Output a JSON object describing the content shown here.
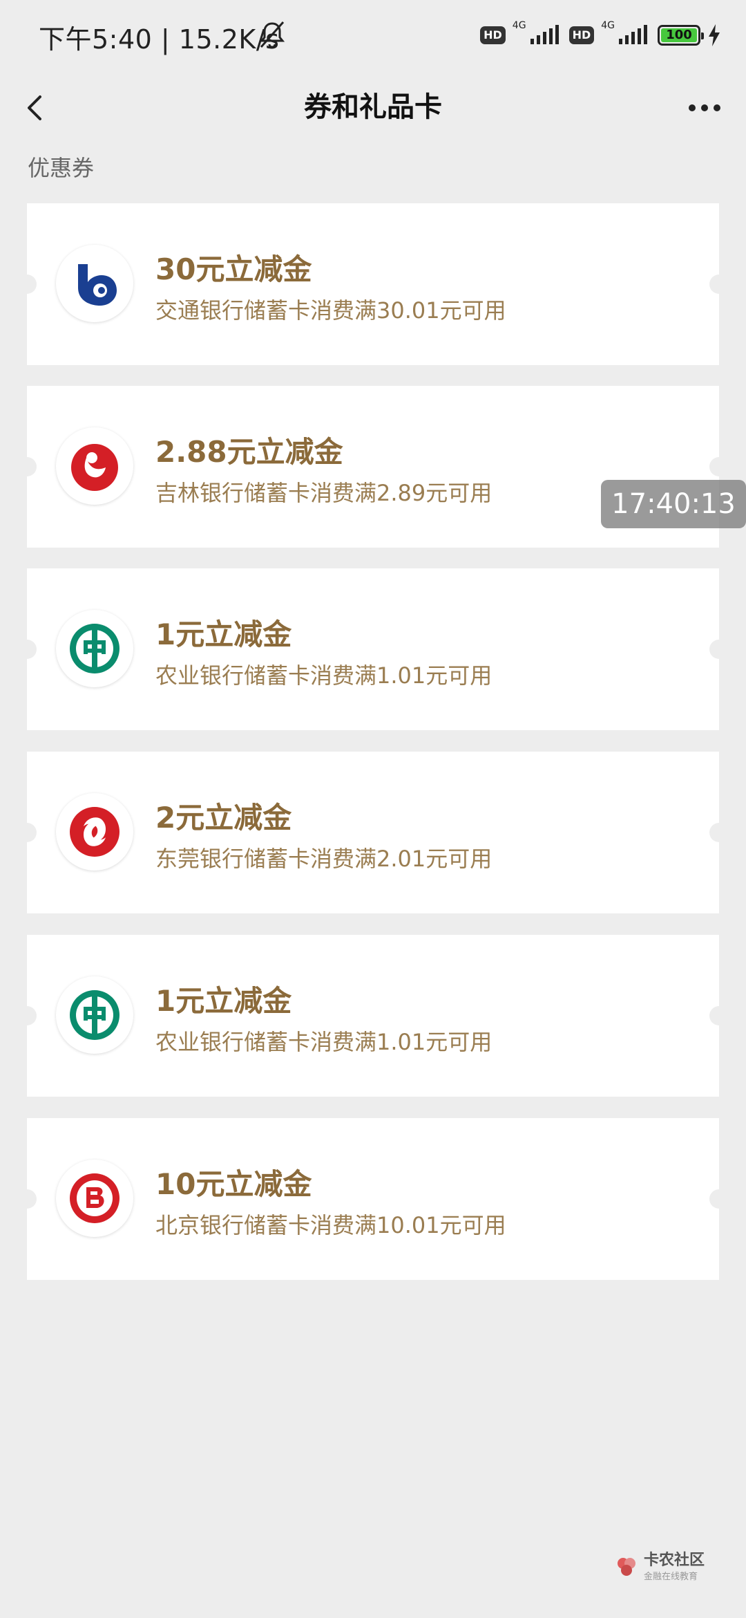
{
  "status_bar": {
    "time": "下午5:40 | 15.2K/s",
    "net1": "4G",
    "net2": "4G",
    "hd": "HD",
    "battery": "100"
  },
  "header": {
    "title": "券和礼品卡"
  },
  "section": {
    "label": "优惠券"
  },
  "coupons": [
    {
      "title": "30元立减金",
      "desc": "交通银行储蓄卡消费满30.01元可用",
      "icon": "bank-of-communications-logo",
      "color": "#1a3f91"
    },
    {
      "title": "2.88元立减金",
      "desc": "吉林银行储蓄卡消费满2.89元可用",
      "icon": "bank-of-jilin-logo",
      "color": "#d41f26"
    },
    {
      "title": "1元立减金",
      "desc": "农业银行储蓄卡消费满1.01元可用",
      "icon": "agricultural-bank-logo",
      "color": "#0a8c6d"
    },
    {
      "title": "2元立减金",
      "desc": "东莞银行储蓄卡消费满2.01元可用",
      "icon": "dongguan-bank-logo",
      "color": "#d41f26"
    },
    {
      "title": "1元立减金",
      "desc": "农业银行储蓄卡消费满1.01元可用",
      "icon": "agricultural-bank-logo",
      "color": "#0a8c6d"
    },
    {
      "title": "10元立减金",
      "desc": "北京银行储蓄卡消费满10.01元可用",
      "icon": "bank-of-beijing-logo",
      "color": "#d41f26"
    }
  ],
  "overlay": {
    "timestamp": "17:40:13"
  },
  "watermark": {
    "text": "卡农社区",
    "sub": "金融在线教育"
  }
}
